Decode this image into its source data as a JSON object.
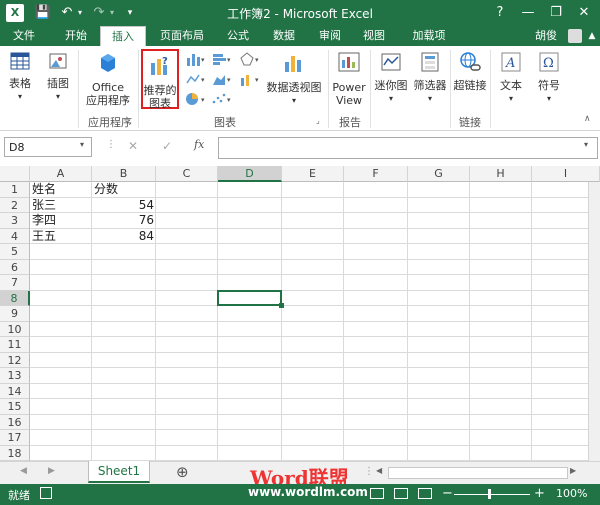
{
  "window": {
    "title": "工作簿2 - Microsoft Excel",
    "help": "?",
    "minimize": "—",
    "restore": "❐",
    "close": "✕"
  },
  "qat": {
    "app_icon": "X",
    "save": "💾",
    "undo": "↶",
    "redo": "↷"
  },
  "tabs": {
    "file": "文件",
    "items": [
      "开始",
      "插入",
      "页面布局",
      "公式",
      "数据",
      "审阅",
      "视图",
      "加载项"
    ],
    "active": "插入",
    "user": "胡俊"
  },
  "ribbon": {
    "table": "表格",
    "illustrations": "插图",
    "office_apps": "Office\n应用程序",
    "recommended_charts": "推荐的\n图表",
    "pivot_chart": "数据透视图",
    "power_view": "Power\nView",
    "sparklines": "迷你图",
    "filters": "筛选器",
    "hyperlink": "超链接",
    "text": "文本",
    "symbols": "符号",
    "groups": {
      "apps": "应用程序",
      "charts": "图表",
      "reports": "报告",
      "links": "链接"
    }
  },
  "formula_bar": {
    "name_box": "D8",
    "fx": "fx",
    "cancel": "✕",
    "enter": "✓",
    "value": ""
  },
  "grid": {
    "columns": [
      "A",
      "B",
      "C",
      "D",
      "E",
      "F",
      "G",
      "H",
      "I"
    ],
    "rows": [
      "1",
      "2",
      "3",
      "4",
      "5",
      "6",
      "7",
      "8",
      "9",
      "10",
      "11",
      "12",
      "13",
      "14",
      "15",
      "16",
      "17",
      "18"
    ],
    "cells": [
      {
        "row": "1",
        "col": "A",
        "value": "姓名"
      },
      {
        "row": "1",
        "col": "B",
        "value": "分数"
      },
      {
        "row": "2",
        "col": "A",
        "value": "张三"
      },
      {
        "row": "2",
        "col": "B",
        "value": "54"
      },
      {
        "row": "3",
        "col": "A",
        "value": "李四"
      },
      {
        "row": "3",
        "col": "B",
        "value": "76"
      },
      {
        "row": "4",
        "col": "A",
        "value": "王五"
      },
      {
        "row": "4",
        "col": "B",
        "value": "84"
      }
    ],
    "selected": "D8"
  },
  "sheets": {
    "active": "Sheet1",
    "add": "⊕"
  },
  "watermark": {
    "brand": "Word联盟",
    "url": "www.wordlm.com"
  },
  "status": {
    "ready": "就绪",
    "zoom": "100%",
    "zoom_minus": "−",
    "zoom_plus": "+"
  }
}
